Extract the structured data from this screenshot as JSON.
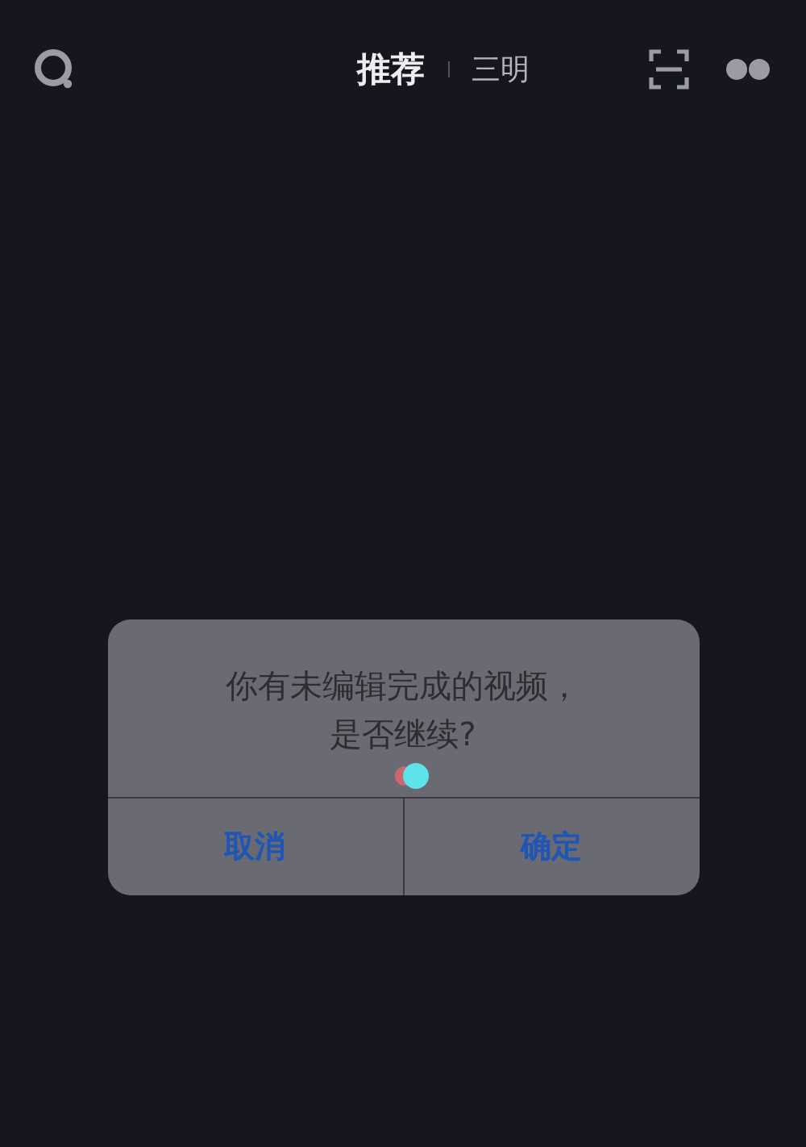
{
  "tabs": [
    {
      "label": "推荐",
      "selected": true
    },
    {
      "label": "三明",
      "selected": false
    }
  ],
  "dialog": {
    "message": "你有未编辑完成的视频，是否继续?",
    "buttons": [
      "取消",
      "确定"
    ]
  }
}
